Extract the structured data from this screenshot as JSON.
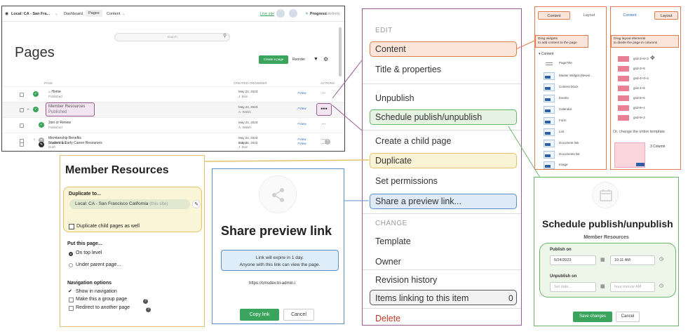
{
  "main": {
    "topbar": {
      "site": "Local: CA - San Fra...",
      "dashboard": "Dashboard",
      "pages": "Pages",
      "content": "Content",
      "live_site": "Live site",
      "brand": "Progress",
      "brand_sub": "Sitefinity"
    },
    "search_placeholder": "Search",
    "title": "Pages",
    "create_button": "Create a page",
    "reorder": "Reorder",
    "columns": {
      "page": "PAGE",
      "created": "CREATED ON/OWNER",
      "actions": "ACTIONS"
    },
    "view_label": "View",
    "rows": [
      {
        "title": "Home",
        "status": "Published",
        "date": "May 24, 2023",
        "owner": "J. Doe"
      },
      {
        "title": "Member Resources",
        "status": "Published",
        "date": "May 24, 2023",
        "owner": "A. Walsh"
      },
      {
        "title": "Join or Renew",
        "status": "Published",
        "date": "May 24, 2023",
        "owner": "A. Walsh"
      },
      {
        "title": "Membership Benefits",
        "status": "Unpublished",
        "date": "May 24, 2023",
        "owner": "J. Doe"
      },
      {
        "title": "Student & Early Career Resources",
        "status": "Draft",
        "date": "May 24, 2023",
        "owner": "J. Doe"
      }
    ]
  },
  "member": {
    "title": "Member Resources",
    "duplicate_to": "Duplicate to...",
    "site_value": "Local: CA - San Francisco California",
    "site_hint": "(this site)",
    "duplicate_child": "Duplicate child pages as well",
    "put_page": "Put this page...",
    "on_top": "On top level",
    "under_parent": "Under parent page...",
    "nav_options": "Navigation options",
    "show_nav": "Show in navigation",
    "group_page": "Make this a group page",
    "redirect": "Redirect to another page"
  },
  "share": {
    "title": "Share preview link",
    "info_line1": "Link will expire in 1 day.",
    "info_line2": "Anyone with this link can view the page.",
    "url": "https://cmsdev.tri-admin.i",
    "copy": "Copy link",
    "cancel": "Cancel"
  },
  "menu": {
    "edit_header": "EDIT",
    "change_header": "CHANGE",
    "items": {
      "content": "Content",
      "title_props": "Title & properties",
      "unpublish": "Unpublish",
      "schedule": "Schedule publish/unpublish",
      "child": "Create a child page",
      "duplicate": "Duplicate",
      "permissions": "Set permissions",
      "preview": "Share a preview link...",
      "template": "Template",
      "owner": "Owner",
      "revision": "Revision history",
      "linking": "Items linking to this item",
      "linking_count": "0",
      "delete": "Delete"
    }
  },
  "contentp": {
    "tab_content": "Content",
    "tab_layout": "Layout",
    "hint_line1": "Drag widgets",
    "hint_line2": "to add content to the page",
    "group": "Content",
    "widgets": [
      "PageTitle",
      "Master Widget (News/...",
      "Content block",
      "Events",
      "Calendar",
      "Form",
      "List",
      "Document link",
      "Documents list",
      "Image"
    ]
  },
  "layoutp": {
    "tab_content": "Content",
    "tab_layout": "Layout",
    "hint_line1": "Drag layout elements",
    "hint_line2": "to divide the page in columns",
    "grids": [
      "grid-3+6+3",
      "grid-3+9",
      "grid-4+4+4",
      "grid-4+8",
      "grid-6+6",
      "grid-8+4",
      "grid-9+3"
    ],
    "change_template": "Or, change the entire template",
    "template_name": "3 Column"
  },
  "sched": {
    "title": "Schedule publish/unpublish",
    "subtitle": "Member Resources",
    "publish_on": "Publish on",
    "pub_date": "5/24/2023",
    "pub_time": "10:11 AM",
    "unpublish_on": "Unpublish on",
    "unpub_date_placeholder": "Set date...",
    "unpub_time_placeholder": "hour:minute AM",
    "save": "Save changes",
    "cancel": "Cancel"
  },
  "colors": {
    "green": "#3aa35c",
    "orange": "#e07d4f",
    "purple": "#9c5a95",
    "yellow": "#e3c26a",
    "blue": "#5b8fc9",
    "pink": "#e87f93"
  }
}
